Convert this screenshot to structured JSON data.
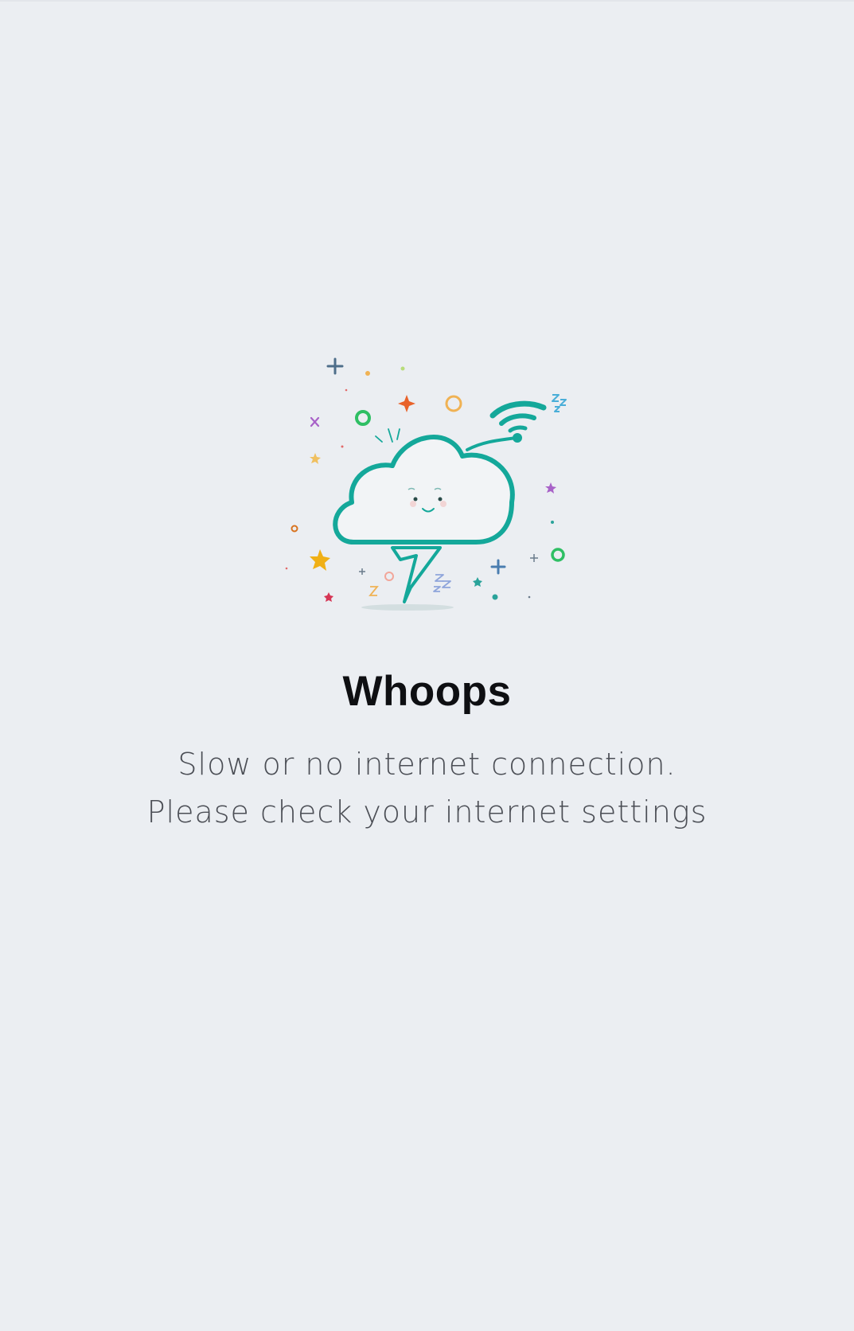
{
  "error": {
    "title": "Whoops",
    "message_line1": "Slow or no internet connection.",
    "message_line2": "Please check your internet settings"
  },
  "illustration": {
    "icon": "offline-cloud-icon",
    "accent_color": "#14a89a"
  },
  "colors": {
    "background": "#ebeef2",
    "title": "#0e0f12",
    "message": "#4b4e55"
  }
}
